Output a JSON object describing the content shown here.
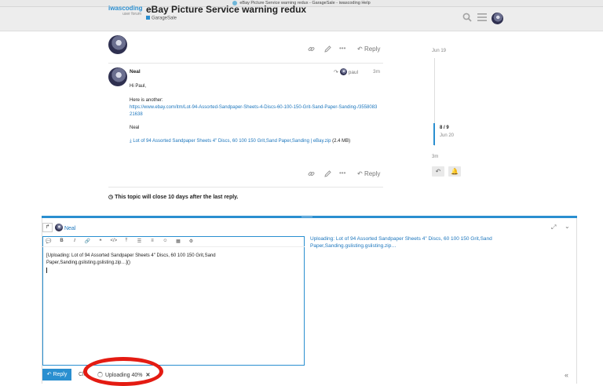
{
  "browser": {
    "tab_title": "eBay Picture Service warning redux - GarageSale - iwascoding Help"
  },
  "header": {
    "logo_main_a": "iwas",
    "logo_main_b": "coding",
    "logo_sub": "user forum",
    "topic_title": "eBay Picture Service warning redux",
    "category": "GarageSale",
    "icons": [
      "search-icon",
      "hamburger-icon",
      "user-avatar"
    ]
  },
  "first_post": {
    "actions": {
      "link_icon": "link-icon",
      "edit_icon": "pencil-icon",
      "more_icon": "ellipsis-icon",
      "reply_label": "Reply"
    }
  },
  "post": {
    "author": "Neal",
    "reply_to_user": "paul",
    "time": "3m",
    "greeting": "Hi Paul,",
    "line2": "Here is another:",
    "url": "https://www.ebay.com/itm/Lot-94-Assorted-Sandpaper-Sheets-4-Discs-60-100-150-Grit-Sand-Paper-Sanding-/355808321638",
    "signature": "Neal",
    "attachment_name": "Lot of 94 Assorted Sandpaper Sheets 4\" Discs, 60 100 150 Grit,Sand Paper,Sanding | eBay.zip",
    "attachment_size": "(2.4 MB)",
    "reply_label": "Reply"
  },
  "timeline": {
    "top_date": "Jun 19",
    "position": "8 / 9",
    "position_date": "Jun 20",
    "bottom_time": "3m"
  },
  "topic_notice": "This topic will close 10 days after the last reply.",
  "composer": {
    "reply_to_name": "Neal",
    "toolbar_icons": [
      "quote-icon",
      "bold-icon",
      "italic-icon",
      "link-icon",
      "blockquote-icon",
      "code-icon",
      "upload-icon",
      "bullet-list-icon",
      "numbered-list-icon",
      "emoji-icon",
      "date-icon",
      "gear-icon"
    ],
    "editor_text": "[Uploading: Lot of 94 Assorted Sandpaper Sheets 4\" Discs, 60 100 150 Grit,Sand Paper,Sanding.gslisting.gslisting.zip…]()",
    "preview_text": "Uploading: Lot of 94 Assorted Sandpaper Sheets 4\" Discs, 60 100 150 Grit,Sand Paper,Sanding.gslisting.gslisting.zip…",
    "reply_button": "Reply",
    "close_label": "Clo",
    "upload_status": "Uploading 40%",
    "upload_progress_percent": 40,
    "cancel_symbol": "✕",
    "collapse_symbol": "«",
    "highlight_color": "#e41b12",
    "accent_color": "#2a8fd0"
  }
}
